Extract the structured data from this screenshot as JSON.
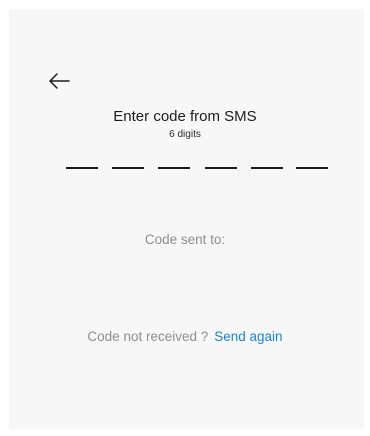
{
  "header": {
    "back_icon": "arrow-left-icon"
  },
  "verification": {
    "title": "Enter code from SMS",
    "subtitle": "6 digits",
    "code_length": 6,
    "code_slots": [
      "",
      "",
      "",
      "",
      "",
      ""
    ]
  },
  "info": {
    "sent_to_label": "Code sent to:"
  },
  "resend": {
    "prompt": "Code not received ?",
    "link": "Send again",
    "link_color": "#1a85d6"
  }
}
